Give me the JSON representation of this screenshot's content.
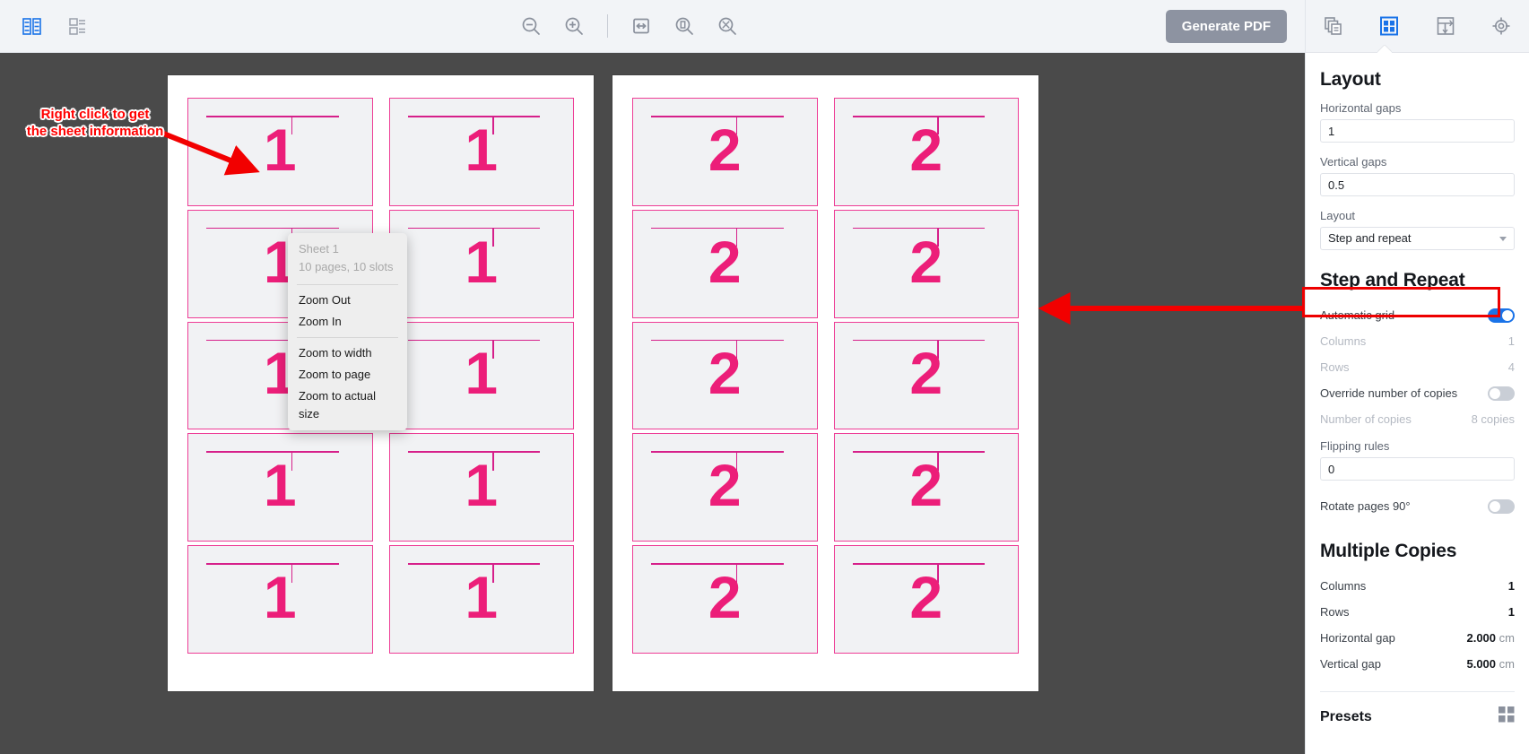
{
  "toolbar": {
    "left_icons": [
      {
        "name": "compare-view-icon",
        "title": "Compare view"
      },
      {
        "name": "save-icon",
        "title": "Save"
      }
    ],
    "center_icons": [
      {
        "name": "zoom-out-icon",
        "title": "Zoom Out"
      },
      {
        "name": "zoom-in-icon",
        "title": "Zoom In"
      },
      {
        "name": "zoom-to-width-icon",
        "title": "Zoom to width"
      },
      {
        "name": "zoom-to-page-icon",
        "title": "Zoom to page"
      },
      {
        "name": "zoom-to-actual-size-icon",
        "title": "Zoom to actual size"
      }
    ],
    "generate_pdf_label": "Generate PDF"
  },
  "panel_tabs": [
    {
      "name": "tab-pages",
      "icon": "copy-pages-icon",
      "active": false
    },
    {
      "name": "tab-layout",
      "icon": "grid-layout-icon",
      "active": true
    },
    {
      "name": "tab-marks",
      "icon": "marks-icon",
      "active": false
    },
    {
      "name": "tab-registration",
      "icon": "registration-target-icon",
      "active": false
    }
  ],
  "panel": {
    "layout": {
      "title": "Layout",
      "horizontal_gaps_label": "Horizontal gaps",
      "horizontal_gaps_value": "1",
      "vertical_gaps_label": "Vertical gaps",
      "vertical_gaps_value": "0.5",
      "layout_label": "Layout",
      "layout_value": "Step and repeat",
      "layout_options": [
        "Step and repeat"
      ]
    },
    "step_and_repeat": {
      "title": "Step and Repeat",
      "rows": [
        {
          "label": "Automatic grid",
          "type": "toggle",
          "on": true,
          "muted": false,
          "highlighted": true
        },
        {
          "label": "Columns",
          "type": "value",
          "value": "1",
          "muted": true
        },
        {
          "label": "Rows",
          "type": "value",
          "value": "4",
          "muted": true
        },
        {
          "label": "Override number of copies",
          "type": "toggle",
          "on": false,
          "muted": false
        },
        {
          "label": "Number of copies",
          "type": "value",
          "value": "8 copies",
          "muted": true
        }
      ],
      "flipping_rules_label": "Flipping rules",
      "flipping_rules_value": "0",
      "rotate_label": "Rotate pages 90°",
      "rotate_on": false
    },
    "multiple_copies": {
      "title": "Multiple Copies",
      "rows": [
        {
          "label": "Columns",
          "value": "1",
          "unit": ""
        },
        {
          "label": "Rows",
          "value": "1",
          "unit": ""
        },
        {
          "label": "Horizontal gap",
          "value": "2.000",
          "unit": "cm"
        },
        {
          "label": "Vertical gap",
          "value": "5.000",
          "unit": "cm"
        }
      ]
    },
    "presets": {
      "title": "Presets",
      "icon": "presets-grid-icon"
    }
  },
  "context_menu": {
    "header_title": "Sheet 1",
    "header_subtitle": "10 pages, 10 slots",
    "groups": [
      [
        "Zoom Out",
        "Zoom In"
      ],
      [
        "Zoom to width",
        "Zoom to page",
        "Zoom to actual size"
      ]
    ]
  },
  "canvas": {
    "sheets": [
      {
        "label": "1",
        "slot_number": "1",
        "slot_count": 10
      },
      {
        "label": "2",
        "slot_number": "2",
        "slot_count": 10
      }
    ]
  },
  "annotations": [
    {
      "name": "annotation-right-click",
      "text": "Right click to get\nthe sheet information",
      "color": "#ff0000"
    },
    {
      "name": "annotation-automatic-grid-arrow",
      "text": "",
      "color": "#ff0000"
    }
  ],
  "colors": {
    "accent_blue": "#1a73e8",
    "magenta": "#ec1e79",
    "magenta_dark": "#d6208a",
    "annotation_red": "#ff0000",
    "toolbar_bg": "#f2f4f7",
    "canvas_bg": "#4a4a4a",
    "button_grey": "#8d93a1"
  }
}
